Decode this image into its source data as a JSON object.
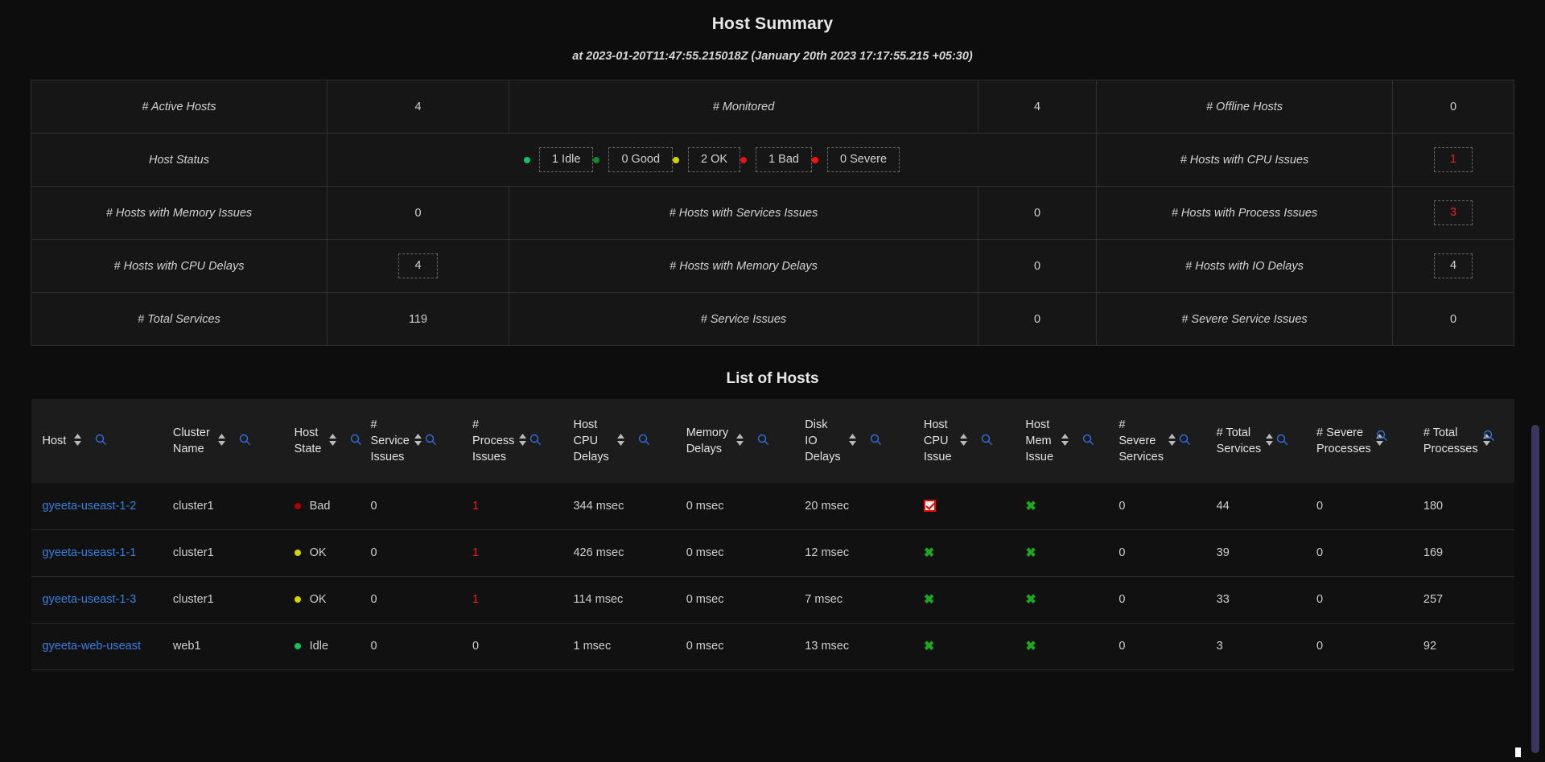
{
  "header": {
    "title": "Host Summary",
    "subtitle": "at 2023-01-20T11:47:55.215018Z (January 20th 2023 17:17:55.215 +05:30)"
  },
  "summary": {
    "rows": [
      {
        "label1": "# Active Hosts",
        "value1": "4",
        "label2": "# Monitored",
        "value2": "4",
        "label3": "# Offline Hosts",
        "value3": "0"
      },
      {
        "label1": "Host Status",
        "value1": "",
        "label2": "",
        "value2": "",
        "label3": "# Hosts with CPU Issues",
        "value3": "1"
      },
      {
        "label1": "# Hosts with Memory Issues",
        "value1": "0",
        "label2": "# Hosts with Services Issues",
        "value2": "0",
        "label3": "# Hosts with Process Issues",
        "value3": "3"
      },
      {
        "label1": "# Hosts with CPU Delays",
        "value1": "4",
        "label2": "# Hosts with Memory Delays",
        "value2": "0",
        "label3": "# Hosts with IO Delays",
        "value3": "4"
      },
      {
        "label1": "# Total Services",
        "value1": "119",
        "label2": "# Service Issues",
        "value2": "0",
        "label3": "# Severe Service Issues",
        "value3": "0"
      }
    ],
    "status_chips": [
      {
        "label": "1 Idle",
        "color": "#16c060"
      },
      {
        "label": "0 Good",
        "color": "#108a28"
      },
      {
        "label": "2 OK",
        "color": "#d6d400"
      },
      {
        "label": "1 Bad",
        "color": "#e01414"
      },
      {
        "label": "0 Severe",
        "color": "#ff1010"
      }
    ]
  },
  "hosts_section": {
    "title": "List of Hosts",
    "columns": [
      {
        "label": "Host",
        "sort": true,
        "search": true
      },
      {
        "label": "Cluster\nName",
        "sort": true,
        "search": true
      },
      {
        "label": "Host\nState",
        "sort": true,
        "search": true
      },
      {
        "label": "#\nService\nIssues",
        "sort": true,
        "search": true
      },
      {
        "label": "#\nProcess\nIssues",
        "sort": true,
        "search": true
      },
      {
        "label": "Host\nCPU\nDelays",
        "sort": true,
        "search": true
      },
      {
        "label": "Memory\nDelays",
        "sort": true,
        "search": true
      },
      {
        "label": "Disk\nIO\nDelays",
        "sort": true,
        "search": true
      },
      {
        "label": "Host\nCPU\nIssue",
        "sort": true,
        "search": true
      },
      {
        "label": "Host\nMem\nIssue",
        "sort": true,
        "search": true
      },
      {
        "label": "#\nSevere\nServices",
        "sort": true,
        "search": true
      },
      {
        "label": "# Total\nServices",
        "sort": true,
        "search": true
      },
      {
        "label": "# Severe\nProcesses",
        "sort": true,
        "search": true
      },
      {
        "label": "# Total\nProcesses",
        "sort": true,
        "search": true
      }
    ],
    "rows": [
      {
        "host": "gyeeta-useast-1-2",
        "cluster": "cluster1",
        "state": "Bad",
        "state_color": "#b00000",
        "service_issues": "0",
        "process_issues": "1",
        "process_issues_red": true,
        "cpu_delays": "344 msec",
        "memory_delays": "0 msec",
        "io_delays": "20 msec",
        "cpu_issue": "checked",
        "mem_issue": "x",
        "severe_services": "0",
        "total_services": "44",
        "severe_processes": "0",
        "total_processes": "180"
      },
      {
        "host": "gyeeta-useast-1-1",
        "cluster": "cluster1",
        "state": "OK",
        "state_color": "#d6d400",
        "service_issues": "0",
        "process_issues": "1",
        "process_issues_red": true,
        "cpu_delays": "426 msec",
        "memory_delays": "0 msec",
        "io_delays": "12 msec",
        "cpu_issue": "x",
        "mem_issue": "x",
        "severe_services": "0",
        "total_services": "39",
        "severe_processes": "0",
        "total_processes": "169"
      },
      {
        "host": "gyeeta-useast-1-3",
        "cluster": "cluster1",
        "state": "OK",
        "state_color": "#d6d400",
        "service_issues": "0",
        "process_issues": "1",
        "process_issues_red": true,
        "cpu_delays": "114 msec",
        "memory_delays": "0 msec",
        "io_delays": "7 msec",
        "cpu_issue": "x",
        "mem_issue": "x",
        "severe_services": "0",
        "total_services": "33",
        "severe_processes": "0",
        "total_processes": "257"
      },
      {
        "host": "gyeeta-web-useast",
        "cluster": "web1",
        "state": "Idle",
        "state_color": "#16c060",
        "service_issues": "0",
        "process_issues": "0",
        "process_issues_red": false,
        "cpu_delays": "1 msec",
        "memory_delays": "0 msec",
        "io_delays": "13 msec",
        "cpu_issue": "x",
        "mem_issue": "x",
        "severe_services": "0",
        "total_services": "3",
        "severe_processes": "0",
        "total_processes": "92"
      }
    ]
  },
  "icons": {
    "sort": "sort-updown-icon",
    "search": "magnifier-icon",
    "checked": "checkbox-checked-icon",
    "x": "x-mark-icon"
  }
}
